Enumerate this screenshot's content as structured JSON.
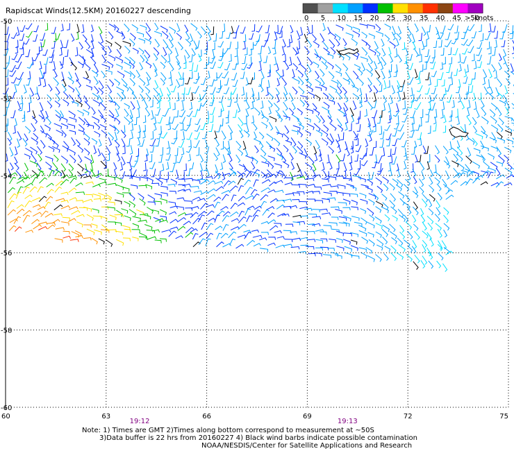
{
  "title": "Rapidscat Winds(12.5KM) 20160227 descending",
  "legend": {
    "ticks": [
      "0",
      "5",
      "10",
      "15",
      "20",
      "25",
      "30",
      "35",
      "40",
      "45",
      ">50"
    ],
    "unit": "knots",
    "colors": [
      "#505050",
      "#a0a0a0",
      "#00e0ff",
      "#00a0ff",
      "#0030ff",
      "#00c000",
      "#ffe000",
      "#ff9000",
      "#ff3000",
      "#8b4513",
      "#ff00ff",
      "#a000c0"
    ]
  },
  "map": {
    "lon_ticks": [
      "60",
      "63",
      "66",
      "69",
      "72",
      "75"
    ],
    "lat_ticks": [
      "-50",
      "-52",
      "-54",
      "-56",
      "-58",
      "-60"
    ],
    "lon_range": [
      60,
      75
    ],
    "lat_range": [
      -50,
      -60
    ],
    "grid": "dotted",
    "times": [
      {
        "label": "19:12",
        "lon": 64.0
      },
      {
        "label": "19:13",
        "lon": 70.2
      }
    ],
    "islands": [
      "kerguelen",
      "heard"
    ]
  },
  "notes": {
    "line1": "Note: 1) Times are GMT 2)Times along bottom correspond to measurement at ~50S",
    "line2": "3)Data buffer is 22 hrs from 20160227 4) Black wind barbs indicate possible contamination",
    "line3": "NOAA/NESDIS/Center for Satellite Applications and Research"
  }
}
